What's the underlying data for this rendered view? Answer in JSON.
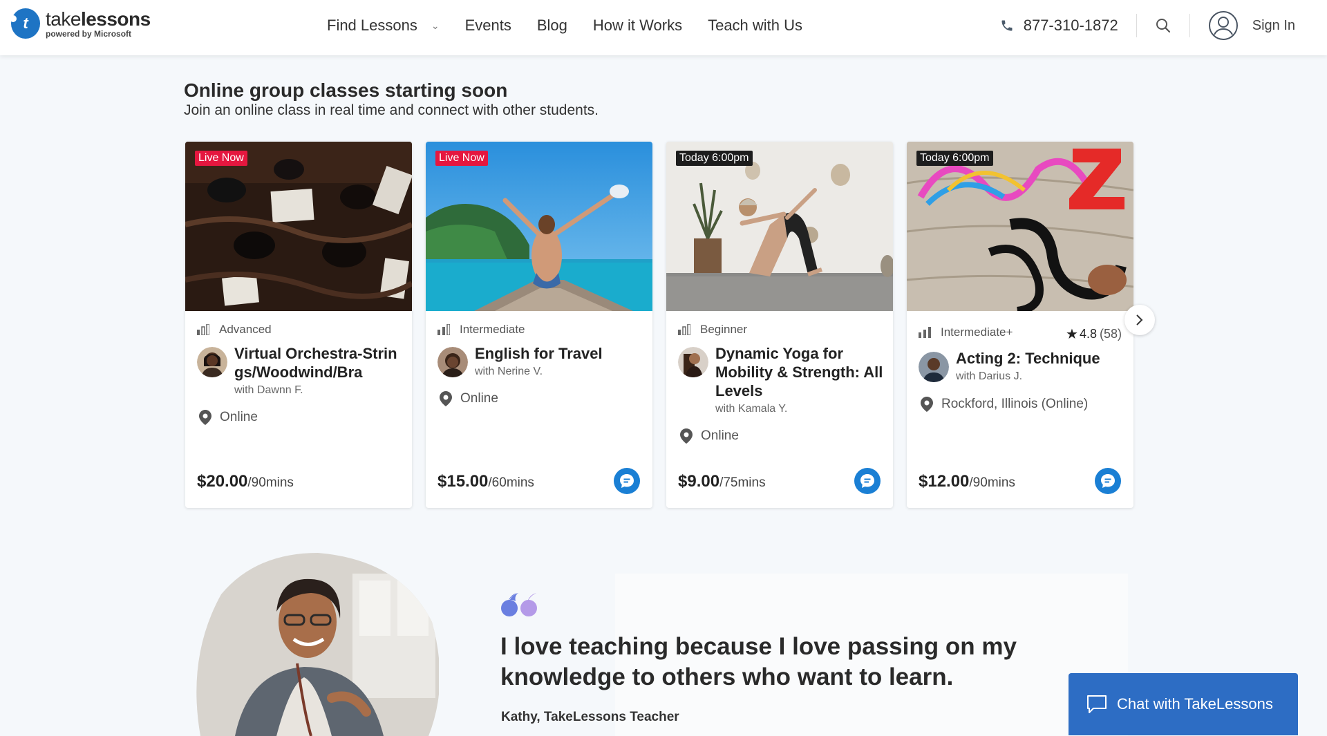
{
  "brand": {
    "name_light": "take",
    "name_bold": "lessons",
    "tagline": "powered by Microsoft",
    "color": "#1e74c4"
  },
  "nav": [
    {
      "label": "Find Lessons",
      "has_dropdown": true
    },
    {
      "label": "Events"
    },
    {
      "label": "Blog"
    },
    {
      "label": "How it Works"
    },
    {
      "label": "Teach with Us"
    }
  ],
  "header": {
    "phone": "877-310-1872",
    "sign_in": "Sign In"
  },
  "section": {
    "title": "Online group classes starting soon",
    "subtitle": "Join an online class in real time and connect with other students."
  },
  "cards": [
    {
      "badge": "Live Now",
      "badge_type": "live",
      "level": "Advanced",
      "title": "Virtual Orchestra-Strings/Woodwind/Bra",
      "teacher": "with Dawnn F.",
      "location": "Online",
      "price": "$20.00",
      "duration": "/90mins",
      "has_message": false
    },
    {
      "badge": "Live Now",
      "badge_type": "live",
      "level": "Intermediate",
      "title": "English for Travel",
      "teacher": "with Nerine V.",
      "location": "Online",
      "price": "$15.00",
      "duration": "/60mins",
      "has_message": true
    },
    {
      "badge": "Today 6:00pm",
      "badge_type": "today",
      "level": "Beginner",
      "title": "Dynamic Yoga for Mobility & Strength: All Levels",
      "teacher": "with Kamala Y.",
      "location": "Online",
      "price": "$9.00",
      "duration": "/75mins",
      "has_message": true
    },
    {
      "badge": "Today 6:00pm",
      "badge_type": "today",
      "level": "Intermediate+",
      "rating": "4.8",
      "rating_count": "(58)",
      "title": "Acting 2: Technique",
      "teacher": "with Darius J.",
      "location": "Rockford, Illinois (Online)",
      "price": "$12.00",
      "duration": "/90mins",
      "has_message": true
    }
  ],
  "testimonial": {
    "quote": "I love teaching because I love passing on my knowledge to others who want to learn.",
    "author": "Kathy, TakeLessons Teacher"
  },
  "chat": {
    "label": "Chat with TakeLessons",
    "color": "#2d6dc4"
  },
  "icons": [
    "phone-icon",
    "search-icon",
    "user-icon",
    "chevron-down-icon",
    "level-bars-icon",
    "location-pin-icon",
    "message-icon",
    "chevron-right-icon",
    "quote-icon",
    "chat-bubble-icon",
    "star-icon"
  ]
}
